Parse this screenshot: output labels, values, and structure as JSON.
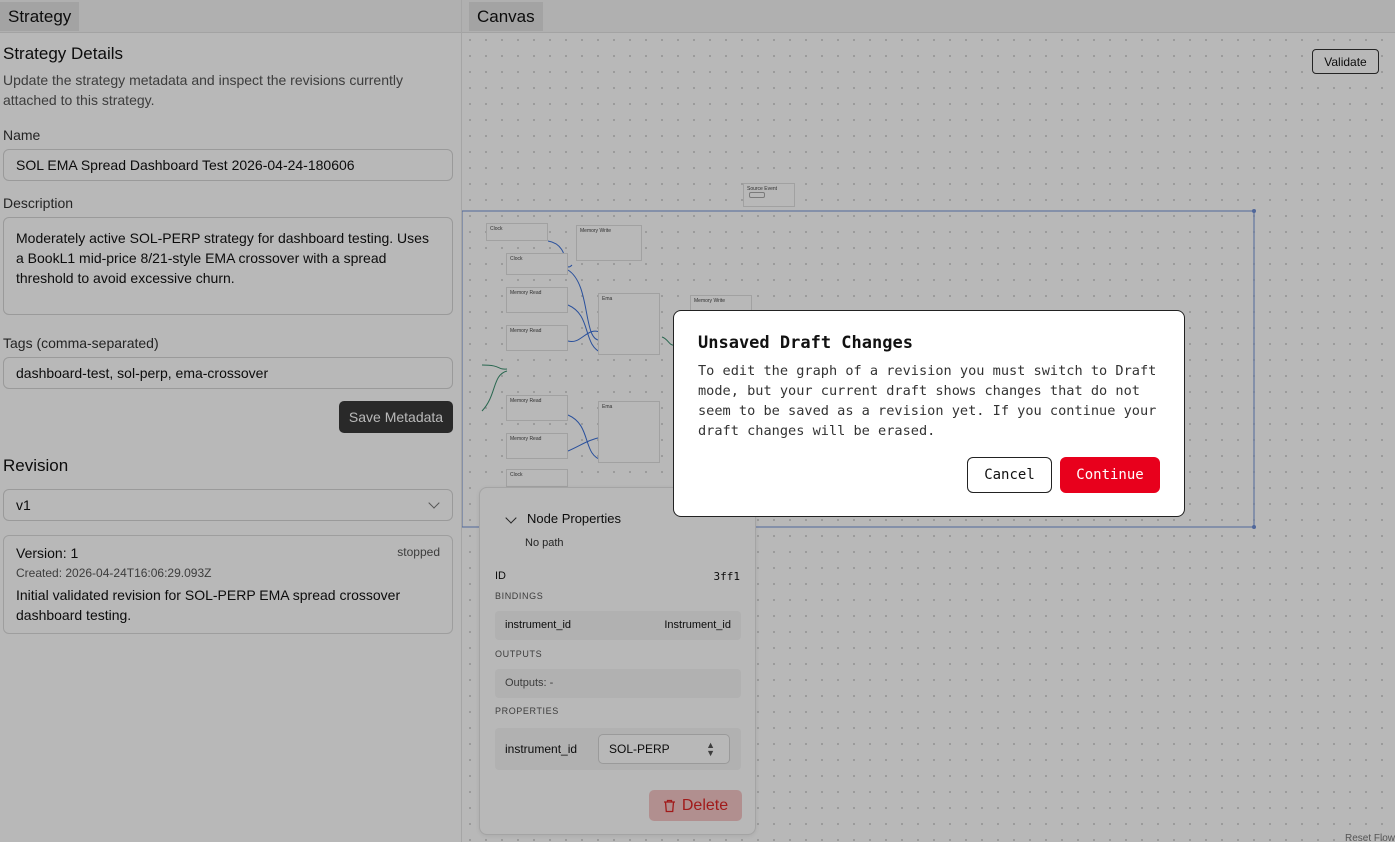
{
  "left": {
    "tab": "Strategy",
    "heading": "Strategy Details",
    "subheading": "Update the strategy metadata and inspect the revisions currently attached to this strategy.",
    "name_label": "Name",
    "name_value": "SOL EMA Spread Dashboard Test 2026-04-24-180606",
    "description_label": "Description",
    "description_value": "Moderately active SOL-PERP strategy for dashboard testing. Uses a BookL1 mid-price 8/21-style EMA crossover with a spread threshold to avoid excessive churn.",
    "tags_label": "Tags (comma-separated)",
    "tags_value": "dashboard-test, sol-perp, ema-crossover",
    "save_button": "Save Metadata",
    "revision_heading": "Revision",
    "revision_selected": "v1",
    "version": {
      "title": "Version: 1",
      "status": "stopped",
      "created": "Created: 2026-04-24T16:06:29.093Z",
      "description": "Initial validated revision for SOL-PERP EMA spread crossover dashboard testing."
    }
  },
  "canvas": {
    "tab": "Canvas",
    "validate_button": "Validate",
    "reset_label": "Reset Flow",
    "mini_nodes": {
      "source_event": "Source Event",
      "clock": "Clock",
      "memory_write": "Memory Write",
      "memory_read": "Memory Read",
      "ema": "Ema",
      "sol_pill": "SOL"
    }
  },
  "props": {
    "title": "Node Properties",
    "path": "No path",
    "id_label": "ID",
    "id_value": "3ff1",
    "bindings_label": "BINDINGS",
    "binding_key": "instrument_id",
    "binding_value": "Instrument_id",
    "outputs_label": "OUTPUTS",
    "outputs_value": "Outputs: -",
    "properties_label": "PROPERTIES",
    "property_key": "instrument_id",
    "property_value": "SOL-PERP",
    "delete_button": "Delete"
  },
  "modal": {
    "title": "Unsaved Draft Changes",
    "body": "To edit the graph of a revision you must switch to Draft mode, but your current draft shows changes that do not seem to be saved as a revision yet. If you continue your draft changes will be erased.",
    "cancel": "Cancel",
    "continue": "Continue"
  },
  "colors": {
    "danger": "#e8001c",
    "selection_blue": "#6f8fd6"
  }
}
